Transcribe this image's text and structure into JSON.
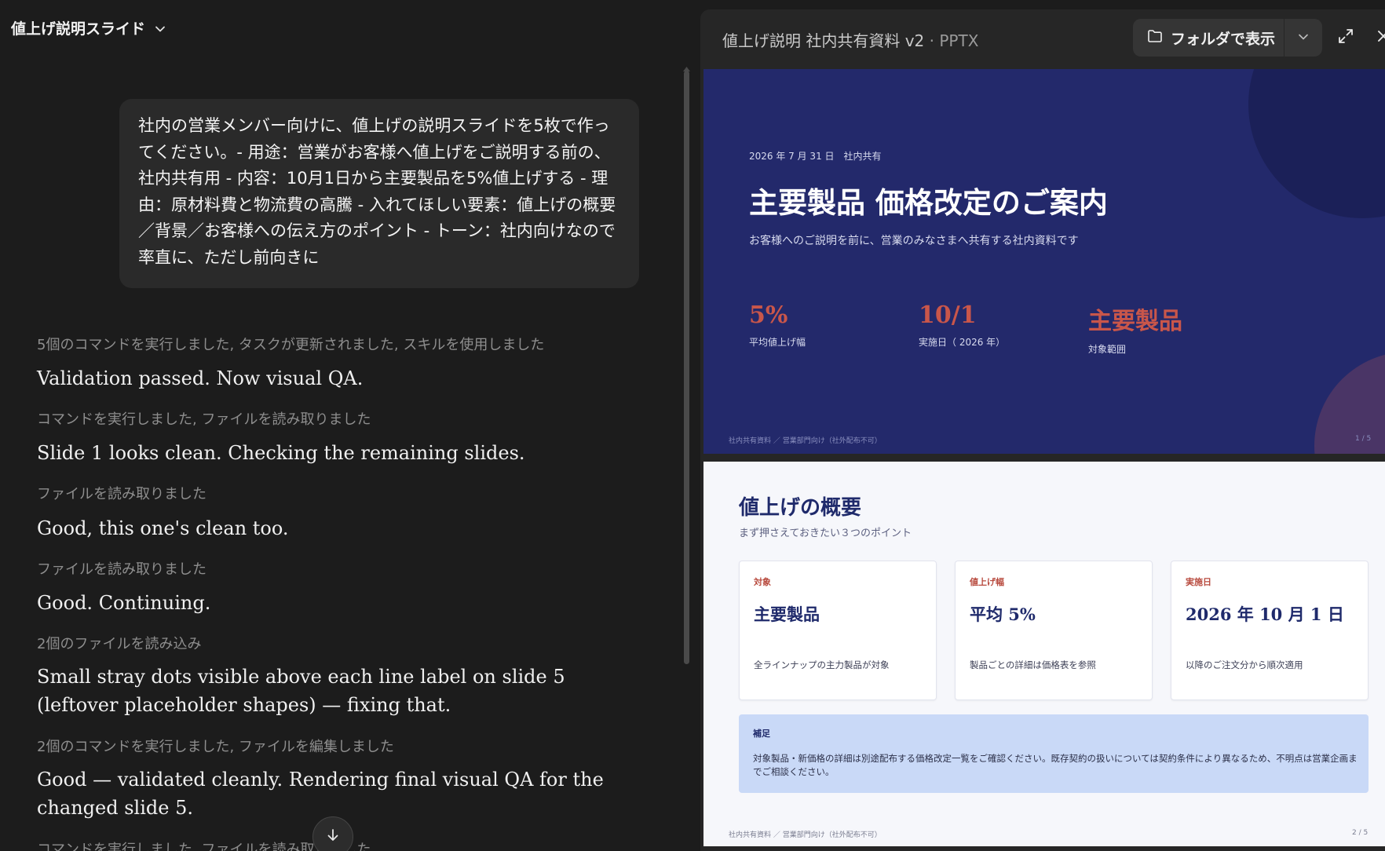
{
  "chat": {
    "title": "値上げ説明スライド",
    "user_message": "社内の営業メンバー向けに、値上げの説明スライドを5枚で作ってください。- 用途：営業がお客様へ値上げをご説明する前の、社内共有用 - 内容：10月1日から主要製品を5%値上げする - 理由：原材料費と物流費の高騰 - 入れてほしい要素：値上げの概要／背景／お客様への伝え方のポイント - トーン：社内向けなので率直に、ただし前向きに",
    "log": [
      {
        "kind": "meta",
        "text": "5個のコマンドを実行しました, タスクが更新されました, スキルを使用しました"
      },
      {
        "kind": "text",
        "text": "Validation passed. Now visual QA."
      },
      {
        "kind": "meta",
        "text": "コマンドを実行しました, ファイルを読み取りました"
      },
      {
        "kind": "text",
        "text": "Slide 1 looks clean. Checking the remaining slides."
      },
      {
        "kind": "meta",
        "text": "ファイルを読み取りました"
      },
      {
        "kind": "text",
        "text": "Good, this one's clean too."
      },
      {
        "kind": "meta",
        "text": "ファイルを読み取りました"
      },
      {
        "kind": "text",
        "text": "Good. Continuing."
      },
      {
        "kind": "meta",
        "text": "2個のファイルを読み込み"
      },
      {
        "kind": "text",
        "text": "Small stray dots visible above each line label on slide 5 (leftover placeholder shapes) — fixing that."
      },
      {
        "kind": "meta",
        "text": "2個のコマンドを実行しました, ファイルを編集しました"
      },
      {
        "kind": "text",
        "text": "Good — validated cleanly. Rendering final visual QA for the changed slide 5."
      },
      {
        "kind": "meta",
        "text": "コマンドを実行しました, ファイルを読み取りました"
      }
    ]
  },
  "preview": {
    "file_name": "値上げ説明 社内共有資料 v2",
    "separator": "·",
    "file_type": "PPTX",
    "folder_button_label": "フォルダで表示"
  },
  "slide1": {
    "date": "2026 年 7 月 31 日　社内共有",
    "title": "主要製品 価格改定のご案内",
    "subtitle": "お客様へのご説明を前に、営業のみなさまへ共有する社内資料です",
    "stats": [
      {
        "value": "5%",
        "label": "平均値上げ幅"
      },
      {
        "value": "10/1",
        "label": "実施日（ 2026 年）"
      },
      {
        "value": "主要製品",
        "label": "対象範囲"
      }
    ],
    "footer": "社内共有資料 ／ 営業部門向け（社外配布不可）",
    "page": "1 / 5"
  },
  "slide2": {
    "title": "値上げの概要",
    "subtitle": "まず押さえておきたい３つのポイント",
    "cards": [
      {
        "label": "対象",
        "value": "主要製品",
        "desc": "全ラインナップの主力製品が対象"
      },
      {
        "label": "値上げ幅",
        "value": "平均 5%",
        "desc": "製品ごとの詳細は価格表を参照"
      },
      {
        "label": "実施日",
        "value": "2026 年 10 月 1 日",
        "desc": "以降のご注文分から順次適用"
      }
    ],
    "note_label": "補足",
    "note_text": "対象製品・新価格の詳細は別途配布する価格改定一覧をご確認ください。既存契約の扱いについては契約条件により異なるため、不明点は営業企画までご相談ください。",
    "footer": "社内共有資料 ／ 営業部門向け（社外配布不可）",
    "page": "2 / 5"
  },
  "colors": {
    "slide1_bg": "#23296b",
    "accent_red": "#c9564a",
    "slide2_note_bg": "#c9d9f7",
    "navy_text": "#1f2a6b"
  },
  "icons": {
    "title_dropdown": "chevron-down-icon",
    "folder": "folder-icon",
    "folder_menu": "chevron-down-icon",
    "expand": "expand-icon",
    "close": "close-icon",
    "scroll_down": "arrow-down-icon"
  }
}
